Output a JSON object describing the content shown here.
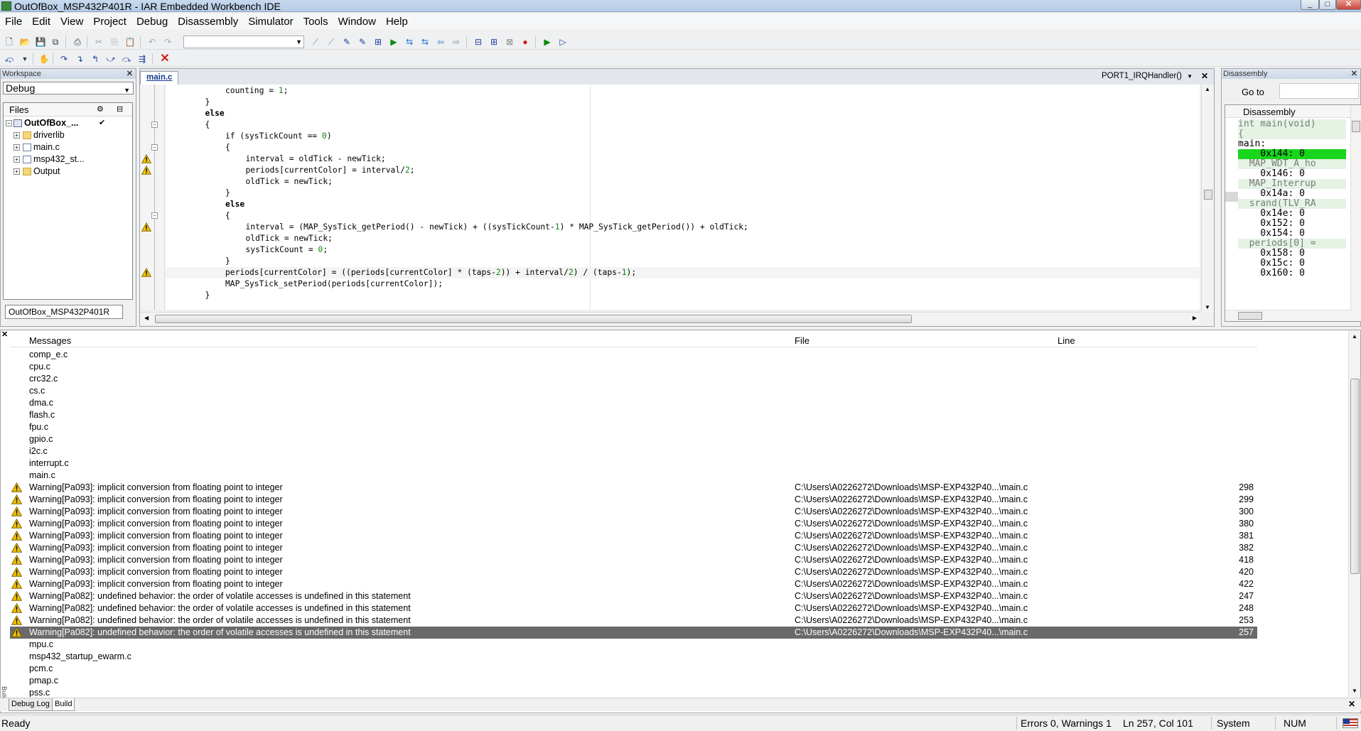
{
  "window": {
    "title": "OutOfBox_MSP432P401R - IAR Embedded Workbench IDE",
    "buttons": [
      "_",
      "□",
      "✕"
    ]
  },
  "menu": [
    "File",
    "Edit",
    "View",
    "Project",
    "Debug",
    "Disassembly",
    "Simulator",
    "Tools",
    "Window",
    "Help"
  ],
  "workspace": {
    "caption": "Workspace",
    "configuration": "Debug",
    "files_header": "Files",
    "tree": [
      {
        "label": "OutOfBox_...",
        "kind": "project",
        "checked": "✔"
      },
      {
        "label": "driverlib",
        "kind": "folder"
      },
      {
        "label": "main.c",
        "kind": "file"
      },
      {
        "label": "msp432_st...",
        "kind": "file"
      },
      {
        "label": "Output",
        "kind": "folder"
      }
    ],
    "tab": "OutOfBox_MSP432P401R"
  },
  "editor": {
    "tab": "main.c",
    "function": "PORT1_IRQHandler()",
    "lines": [
      {
        "indent": 4,
        "parts": [
          [
            "counting = ",
            ""
          ],
          [
            "1",
            "num"
          ],
          [
            ";",
            ""
          ]
        ]
      },
      {
        "indent": 3,
        "parts": [
          [
            "}",
            ""
          ]
        ]
      },
      {
        "indent": 3,
        "parts": [
          [
            "else",
            "kw"
          ]
        ]
      },
      {
        "indent": 3,
        "parts": [
          [
            "{",
            ""
          ]
        ]
      },
      {
        "indent": 4,
        "parts": [
          [
            "if (sysTickCount == ",
            ""
          ],
          [
            "0",
            "num"
          ],
          [
            ")",
            ""
          ]
        ]
      },
      {
        "indent": 4,
        "parts": [
          [
            "{",
            ""
          ]
        ]
      },
      {
        "indent": 5,
        "parts": [
          [
            "interval = oldTick - newTick;",
            ""
          ]
        ]
      },
      {
        "indent": 5,
        "parts": [
          [
            "periods[currentColor] = interval/",
            ""
          ],
          [
            "2",
            "num"
          ],
          [
            ";",
            ""
          ]
        ]
      },
      {
        "indent": 5,
        "parts": [
          [
            "oldTick = newTick;",
            ""
          ]
        ]
      },
      {
        "indent": 4,
        "parts": [
          [
            "}",
            ""
          ]
        ]
      },
      {
        "indent": 4,
        "parts": [
          [
            "else",
            "kw"
          ]
        ]
      },
      {
        "indent": 4,
        "parts": [
          [
            "{",
            ""
          ]
        ]
      },
      {
        "indent": 5,
        "parts": [
          [
            "interval = (MAP_SysTick_getPeriod() - newTick) + ((sysTickCount-",
            ""
          ],
          [
            "1",
            "num"
          ],
          [
            ") * MAP_SysTick_getPeriod()) + oldTick;",
            ""
          ]
        ]
      },
      {
        "indent": 5,
        "parts": [
          [
            "oldTick = newTick;",
            ""
          ]
        ]
      },
      {
        "indent": 5,
        "parts": [
          [
            "sysTickCount = ",
            ""
          ],
          [
            "0",
            "num"
          ],
          [
            ";",
            ""
          ]
        ]
      },
      {
        "indent": 4,
        "parts": [
          [
            "}",
            ""
          ]
        ]
      },
      {
        "indent": 4,
        "parts": [
          [
            "periods[currentColor] = ((periods[currentColor] * (taps-",
            ""
          ],
          [
            "2",
            "num"
          ],
          [
            ")) + interval/",
            ""
          ],
          [
            "2",
            "num"
          ],
          [
            ") / (taps-",
            ""
          ],
          [
            "1",
            "num"
          ],
          [
            ");",
            ""
          ]
        ],
        "current": true
      },
      {
        "indent": 4,
        "parts": [
          [
            "MAP_SysTick_setPeriod(periods[currentColor]);",
            ""
          ]
        ]
      },
      {
        "indent": 3,
        "parts": [
          [
            "}",
            ""
          ]
        ]
      }
    ],
    "warning_lines": [
      6,
      7,
      12,
      16
    ],
    "fold_lines": [
      3,
      5,
      11
    ]
  },
  "disassembly": {
    "caption": "Disassembly",
    "goto_label": "Go to",
    "title": "Disassembly",
    "rows": [
      {
        "text": "int main(void)",
        "kind": "src"
      },
      {
        "text": "{",
        "kind": "src"
      },
      {
        "text": "main:",
        "kind": "addr"
      },
      {
        "text": "    0x144: 0",
        "kind": "current"
      },
      {
        "text": "  MAP_WDT_A_ho",
        "kind": "src"
      },
      {
        "text": "    0x146: 0",
        "kind": "addr"
      },
      {
        "text": "  MAP_Interrup",
        "kind": "src"
      },
      {
        "text": "    0x14a: 0",
        "kind": "addr"
      },
      {
        "text": "  srand(TLV_RA",
        "kind": "src"
      },
      {
        "text": "    0x14e: 0",
        "kind": "addr"
      },
      {
        "text": "    0x152: 0",
        "kind": "addr"
      },
      {
        "text": "    0x154: 0",
        "kind": "addr"
      },
      {
        "text": "  periods[0] =",
        "kind": "src"
      },
      {
        "text": "    0x158: 0",
        "kind": "addr"
      },
      {
        "text": "    0x15c: 0",
        "kind": "addr"
      },
      {
        "text": "    0x160: 0",
        "kind": "addr"
      }
    ]
  },
  "messages": {
    "headers": {
      "messages": "Messages",
      "file": "File",
      "line": "Line"
    },
    "rows": [
      {
        "text": "comp_e.c"
      },
      {
        "text": "cpu.c"
      },
      {
        "text": "crc32.c"
      },
      {
        "text": "cs.c"
      },
      {
        "text": "dma.c"
      },
      {
        "text": "flash.c"
      },
      {
        "text": "fpu.c"
      },
      {
        "text": "gpio.c"
      },
      {
        "text": "i2c.c"
      },
      {
        "text": "interrupt.c"
      },
      {
        "text": "main.c"
      },
      {
        "text": "Warning[Pa093]: implicit conversion from floating point to integer",
        "file": "C:\\Users\\A0226272\\Downloads\\MSP-EXP432P40...\\main.c",
        "line": "298",
        "warn": true
      },
      {
        "text": "Warning[Pa093]: implicit conversion from floating point to integer",
        "file": "C:\\Users\\A0226272\\Downloads\\MSP-EXP432P40...\\main.c",
        "line": "299",
        "warn": true
      },
      {
        "text": "Warning[Pa093]: implicit conversion from floating point to integer",
        "file": "C:\\Users\\A0226272\\Downloads\\MSP-EXP432P40...\\main.c",
        "line": "300",
        "warn": true
      },
      {
        "text": "Warning[Pa093]: implicit conversion from floating point to integer",
        "file": "C:\\Users\\A0226272\\Downloads\\MSP-EXP432P40...\\main.c",
        "line": "380",
        "warn": true
      },
      {
        "text": "Warning[Pa093]: implicit conversion from floating point to integer",
        "file": "C:\\Users\\A0226272\\Downloads\\MSP-EXP432P40...\\main.c",
        "line": "381",
        "warn": true
      },
      {
        "text": "Warning[Pa093]: implicit conversion from floating point to integer",
        "file": "C:\\Users\\A0226272\\Downloads\\MSP-EXP432P40...\\main.c",
        "line": "382",
        "warn": true
      },
      {
        "text": "Warning[Pa093]: implicit conversion from floating point to integer",
        "file": "C:\\Users\\A0226272\\Downloads\\MSP-EXP432P40...\\main.c",
        "line": "418",
        "warn": true
      },
      {
        "text": "Warning[Pa093]: implicit conversion from floating point to integer",
        "file": "C:\\Users\\A0226272\\Downloads\\MSP-EXP432P40...\\main.c",
        "line": "420",
        "warn": true
      },
      {
        "text": "Warning[Pa093]: implicit conversion from floating point to integer",
        "file": "C:\\Users\\A0226272\\Downloads\\MSP-EXP432P40...\\main.c",
        "line": "422",
        "warn": true
      },
      {
        "text": "Warning[Pa082]: undefined behavior: the order of volatile accesses is undefined in this statement",
        "file": "C:\\Users\\A0226272\\Downloads\\MSP-EXP432P40...\\main.c",
        "line": "247",
        "warn": true
      },
      {
        "text": "Warning[Pa082]: undefined behavior: the order of volatile accesses is undefined in this statement",
        "file": "C:\\Users\\A0226272\\Downloads\\MSP-EXP432P40...\\main.c",
        "line": "248",
        "warn": true
      },
      {
        "text": "Warning[Pa082]: undefined behavior: the order of volatile accesses is undefined in this statement",
        "file": "C:\\Users\\A0226272\\Downloads\\MSP-EXP432P40...\\main.c",
        "line": "253",
        "warn": true
      },
      {
        "text": "Warning[Pa082]: undefined behavior: the order of volatile accesses is undefined in this statement",
        "file": "C:\\Users\\A0226272\\Downloads\\MSP-EXP432P40...\\main.c",
        "line": "257",
        "warn": true,
        "selected": true
      },
      {
        "text": "mpu.c"
      },
      {
        "text": "msp432_startup_ewarm.c"
      },
      {
        "text": "pcm.c"
      },
      {
        "text": "pmap.c"
      },
      {
        "text": "pss.c"
      }
    ],
    "tabs": [
      "Debug Log",
      "Build"
    ],
    "active_tab": "Build",
    "side_label": "Build"
  },
  "status": {
    "ready": "Ready",
    "errors": "Errors 0, Warnings 1",
    "position": "Ln 257, Col 101",
    "mode": "System",
    "num": "NUM"
  },
  "colors": {
    "current_pc": "#19d51c",
    "selected_row": "#6a6a6a",
    "number_literal": "#0a8a0a",
    "warning": "#f2c200"
  }
}
